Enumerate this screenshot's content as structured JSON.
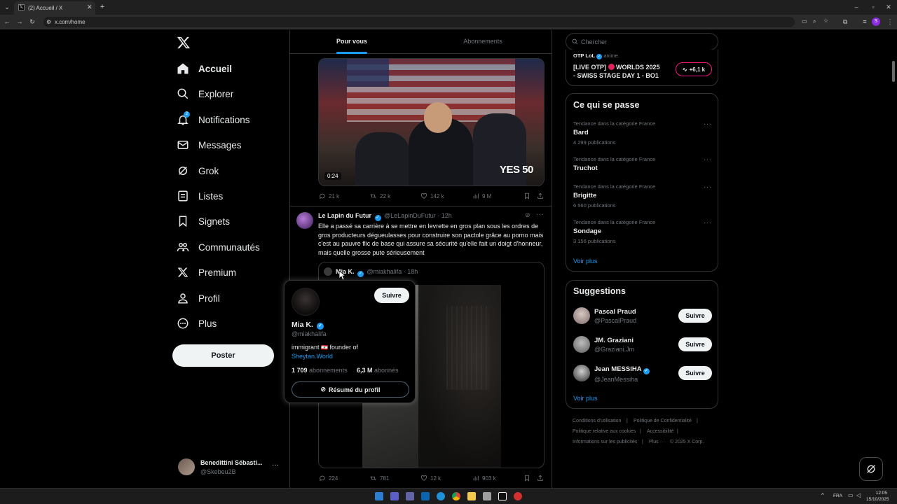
{
  "browser": {
    "tab_title": "(2) Accueil / X",
    "url": "x.com/home",
    "new_tab_symbol": "+",
    "profile_initial": "S"
  },
  "sidebar": {
    "items": [
      {
        "label": "Accueil",
        "icon": "home-icon"
      },
      {
        "label": "Explorer",
        "icon": "search-icon"
      },
      {
        "label": "Notifications",
        "icon": "bell-icon",
        "badge": "2"
      },
      {
        "label": "Messages",
        "icon": "envelope-icon"
      },
      {
        "label": "Grok",
        "icon": "grok-icon"
      },
      {
        "label": "Listes",
        "icon": "list-icon"
      },
      {
        "label": "Signets",
        "icon": "bookmark-icon"
      },
      {
        "label": "Communautés",
        "icon": "communities-icon"
      },
      {
        "label": "Premium",
        "icon": "x-logo-icon"
      },
      {
        "label": "Profil",
        "icon": "person-icon"
      },
      {
        "label": "Plus",
        "icon": "more-circle-icon"
      }
    ],
    "post_button": "Poster",
    "account": {
      "name": "Benedittini Sébasti...",
      "handle": "@Skebeu2B"
    }
  },
  "feed": {
    "tabs": [
      "Pour vous",
      "Abonnements"
    ],
    "video_tweet": {
      "duration": "0:24",
      "watermark": "YES 50",
      "replies": "21 k",
      "retweets": "22 k",
      "likes": "142 k",
      "views": "9 M"
    },
    "tweet": {
      "author": "Le Lapin du Futur",
      "handle": "@LeLapinDuFutur",
      "time": "· 12h",
      "text": "Elle a passé sa carrière à se mettre en levrette en gros plan sous les ordres de gros producteurs dégueulasses pour construire son pactole grâce au porno mais c'est au pauvre flic de base qui assure sa sécurité qu'elle fait un doigt d'honneur, mais quelle grosse pute sérieusement",
      "quoted": {
        "author": "Mia K.",
        "handle": "@miakhalifa",
        "time": "· 18h"
      },
      "replies": "224",
      "retweets": "781",
      "likes": "12 k",
      "views": "903 k"
    },
    "hovercard": {
      "follow": "Suivre",
      "name": "Mia K.",
      "handle": "@miakhalifa",
      "bio_prefix": "immigrant",
      "bio_flag": "🇱🇧",
      "bio_middle": "founder of",
      "bio_link": "Sheytan.World",
      "following_count": "1 709",
      "following_label": "abonnements",
      "followers_count": "6,3 M",
      "followers_label": "abonnés",
      "summary_button": "Résumé du profil"
    }
  },
  "right": {
    "search_placeholder": "Chercher",
    "live": {
      "source": "OTP LoL",
      "source_suffix": "anime.",
      "title_prefix": "[LIVE OTP]",
      "title_suffix": "WORLDS 2025",
      "title_line2": "- SWISS STAGE DAY 1 - BO1",
      "badge": "+6,1 k"
    },
    "trends": {
      "title": "Ce qui se passe",
      "items": [
        {
          "category": "Tendance dans la catégorie France",
          "name": "Bard",
          "count": "4 299 publications"
        },
        {
          "category": "Tendance dans la catégorie France",
          "name": "Truchot",
          "count": ""
        },
        {
          "category": "Tendance dans la catégorie France",
          "name": "Brigitte",
          "count": "6 560 publications"
        },
        {
          "category": "Tendance dans la catégorie France",
          "name": "Sondage",
          "count": "3 156 publications"
        }
      ],
      "more": "Voir plus"
    },
    "suggestions": {
      "title": "Suggestions",
      "items": [
        {
          "name": "Pascal Praud",
          "handle": "@PascalPraud",
          "verified": false,
          "button": "Suivre"
        },
        {
          "name": "JM. Graziani",
          "handle": "@Graziani.Jm",
          "verified": false,
          "button": "Suivre"
        },
        {
          "name": "Jean MESSIHA",
          "handle": "@JeanMessiha",
          "verified": true,
          "button": "Suivre"
        }
      ],
      "more": "Voir plus"
    },
    "footer": {
      "terms": "Conditions d'utilisation",
      "privacy": "Politique de Confidentialité",
      "cookies": "Politique relative aux cookies",
      "accessibility": "Accessibilité",
      "ads": "Informations sur les publicités",
      "more": "Plus ···",
      "copyright": "© 2025 X Corp."
    }
  },
  "taskbar": {
    "lang": "FRA",
    "time": "12:05",
    "date": "15/10/2025"
  },
  "colors": {
    "accent": "#1d9bf0",
    "background": "#000000",
    "border": "#2f3336",
    "muted": "#71767b",
    "live_red": "#f91880"
  }
}
